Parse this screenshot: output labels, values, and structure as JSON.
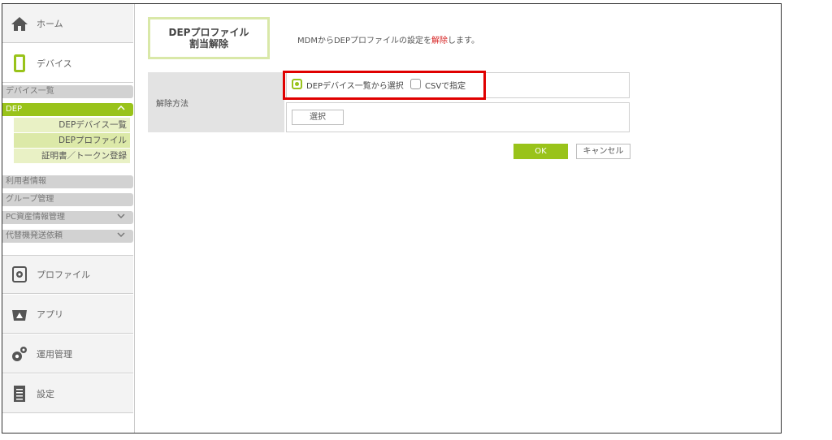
{
  "sidebar": {
    "home": "ホーム",
    "device": "デバイス",
    "device_list": "デバイス一覧",
    "dep": "DEP",
    "dep_children": [
      "DEPデバイス一覧",
      "DEPプロファイル",
      "証明書／トークン登録"
    ],
    "user_info": "利用者情報",
    "group_mgmt": "グループ管理",
    "pc_assets": "PC資産情報管理",
    "replacement": "代替機発送依頼",
    "profile": "プロファイル",
    "app": "アプリ",
    "operation": "運用管理",
    "settings": "設定"
  },
  "page": {
    "title_line1": "DEPプロファイル",
    "title_line2": "割当解除",
    "desc_prefix": "MDMからDEPプロファイルの設定を",
    "desc_red": "解除",
    "desc_suffix": "します。"
  },
  "form": {
    "method_label": "解除方法",
    "option_select": "DEPデバイス一覧から選択",
    "option_csv": "CSVで指定",
    "select_button": "選択",
    "ok": "OK",
    "cancel": "キャンセル"
  },
  "colors": {
    "accent_green": "#99c31a",
    "highlight_red": "#e00000"
  }
}
